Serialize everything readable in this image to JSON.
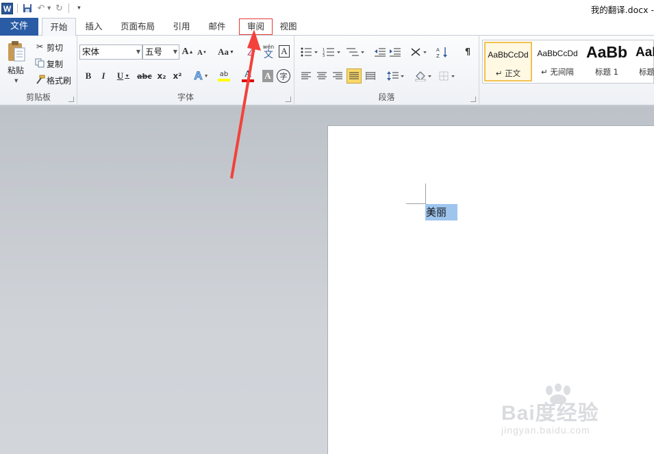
{
  "window": {
    "document_title": "我的翻译.docx -"
  },
  "quick_access": {
    "icons": [
      "word-app-icon",
      "save-icon",
      "undo-icon",
      "redo-icon",
      "customize-icon"
    ]
  },
  "tabs": [
    {
      "label": "文件",
      "state": "file"
    },
    {
      "label": "开始",
      "state": "active"
    },
    {
      "label": "插入",
      "state": "normal"
    },
    {
      "label": "页面布局",
      "state": "normal"
    },
    {
      "label": "引用",
      "state": "normal"
    },
    {
      "label": "邮件",
      "state": "normal"
    },
    {
      "label": "审阅",
      "state": "highlighted"
    },
    {
      "label": "视图",
      "state": "normal"
    }
  ],
  "ribbon": {
    "clipboard": {
      "label": "剪贴板",
      "paste": "粘贴",
      "cut": "剪切",
      "copy": "复制",
      "format_painter": "格式刷"
    },
    "font": {
      "label": "字体",
      "font_name": "宋体",
      "font_size": "五号",
      "change_case": "Aa",
      "pinyin_char": "文",
      "pinyin_top": "wén",
      "char_border": "A",
      "bold": "B",
      "italic": "I",
      "underline": "U",
      "strike": "abc",
      "subscript": "x₂",
      "superscript": "x²",
      "text_effect": "A",
      "highlight": "ab",
      "font_color": "A",
      "char_shading": "A",
      "enclose": "字"
    },
    "paragraph": {
      "label": "段落"
    },
    "styles": {
      "items": [
        {
          "preview": "AaBbCcDd",
          "name": "↵ 正文"
        },
        {
          "preview": "AaBbCcDd",
          "name": "↵ 无间隔"
        },
        {
          "preview": "AaBb",
          "name": "标题 1"
        },
        {
          "preview": "AaB",
          "name": "标题"
        }
      ]
    }
  },
  "document": {
    "selected_text": "美丽"
  },
  "watermark": {
    "main": "Bai度经验",
    "sub": "jingyan.baidu.com"
  },
  "colors": {
    "file_tab": "#2a5ba5",
    "highlight_box": "#e53935",
    "arrow": "#f2423b",
    "selection": "#9ec5ee",
    "style_selected": "#f2c14e"
  }
}
